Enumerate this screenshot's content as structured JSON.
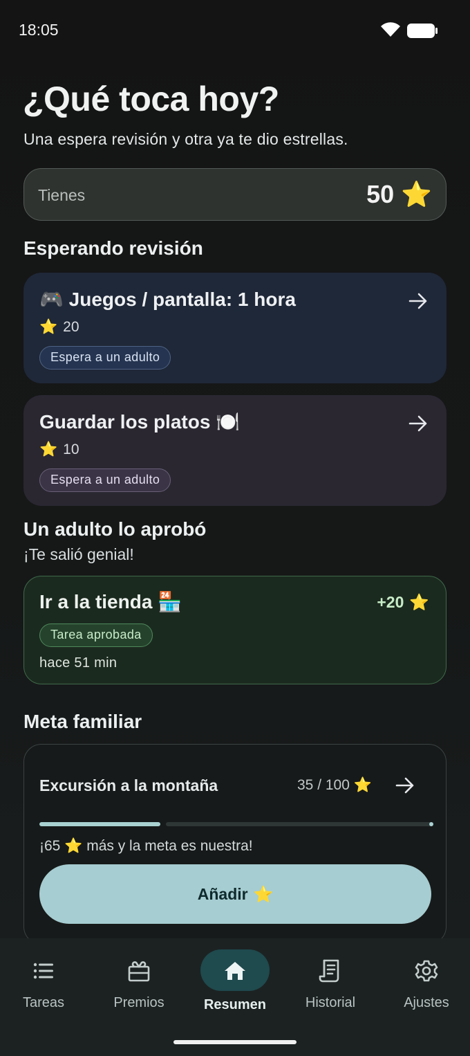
{
  "status_bar": {
    "time": "18:05"
  },
  "header": {
    "title": "¿Qué toca hoy?",
    "subtitle": "Una espera revisión y otra ya te dio estrellas."
  },
  "balance": {
    "label": "Tienes",
    "value": "50",
    "icon": "star-icon"
  },
  "pending": {
    "title": "Esperando revisión",
    "tasks": [
      {
        "title": "🎮 Juegos / pantalla: 1 hora",
        "points": "20",
        "status": "Espera a un adulto"
      },
      {
        "title": "Guardar los platos 🍽️",
        "points": "10",
        "status": "Espera a un adulto"
      }
    ]
  },
  "approved": {
    "title": "Un adulto lo aprobó",
    "subtitle": "¡Te salió genial!",
    "task": {
      "title": "Ir a la tienda 🏪",
      "points": "+20",
      "status": "Tarea aprobada",
      "time": "hace 51 min"
    }
  },
  "goal": {
    "section_title": "Meta familiar",
    "name": "Excursión a la montaña",
    "progress_text": "35 / 100",
    "current": 35,
    "target": 100,
    "message_before": "¡65",
    "message_after": "más y la meta es nuestra!",
    "button_label": "Añadir"
  },
  "nav": {
    "items": [
      {
        "label": "Tareas",
        "icon": "list-icon"
      },
      {
        "label": "Premios",
        "icon": "gift-icon"
      },
      {
        "label": "Resumen",
        "icon": "home-icon"
      },
      {
        "label": "Historial",
        "icon": "receipt-icon"
      },
      {
        "label": "Ajustes",
        "icon": "gear-icon"
      }
    ],
    "active_index": 2
  },
  "colors": {
    "accent": "#a6cdd1",
    "star": "#f6c324",
    "pending_blue": "#1f2838",
    "pending_purple": "#2a2731",
    "approved_green": "#1b2a1f"
  }
}
